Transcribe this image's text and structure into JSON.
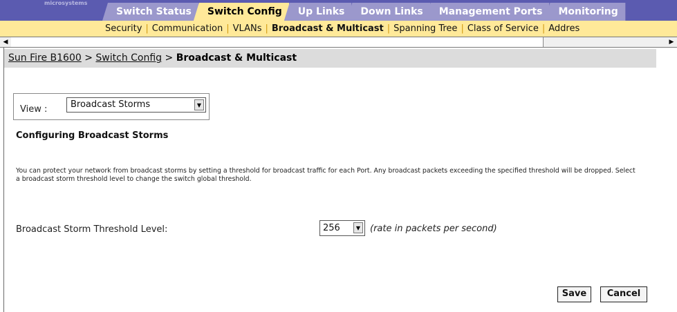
{
  "header": {
    "brand": "microsystems",
    "tabs": [
      {
        "label": "Switch Status",
        "active": false
      },
      {
        "label": "Switch Config",
        "active": true
      },
      {
        "label": "Up Links",
        "active": false
      },
      {
        "label": "Down Links",
        "active": false
      },
      {
        "label": "Management Ports",
        "active": false
      },
      {
        "label": "Monitoring",
        "active": false
      }
    ]
  },
  "subnav": {
    "items": [
      {
        "label": "Security",
        "active": false
      },
      {
        "label": "Communication",
        "active": false
      },
      {
        "label": "VLANs",
        "active": false
      },
      {
        "label": "Broadcast & Multicast",
        "active": true
      },
      {
        "label": "Spanning Tree",
        "active": false
      },
      {
        "label": "Class of Service",
        "active": false
      },
      {
        "label": "Addres",
        "active": false
      }
    ],
    "separator": "|"
  },
  "breadcrumb": {
    "root": "Sun Fire B1600",
    "section": "Switch Config",
    "separator": ">",
    "current": "Broadcast & Multicast"
  },
  "view": {
    "label": "View :",
    "selected": "Broadcast Storms"
  },
  "section_title": "Configuring Broadcast Storms",
  "description": "You can protect your network from broadcast storms by setting a threshold for broadcast traffic for each Port. Any broadcast packets exceeding the specified threshold will be dropped. Select a broadcast storm threshold level to change the switch global threshold.",
  "threshold": {
    "label": "Broadcast Storm Threshold Level:",
    "selected": "256",
    "hint": "(rate in packets per second)"
  },
  "actions": {
    "save": "Save",
    "cancel": "Cancel"
  },
  "icons": {
    "dropdown": "chevron-down-icon",
    "scroll_left": "arrow-left-icon",
    "scroll_right": "arrow-right-icon"
  },
  "colors": {
    "header_bg": "#5b5bb0",
    "tab_bg": "#9b98cc",
    "active_tab_bg": "#ffe999",
    "subnav_bg": "#ffe999",
    "breadcrumb_bg": "#dcdcdc"
  }
}
